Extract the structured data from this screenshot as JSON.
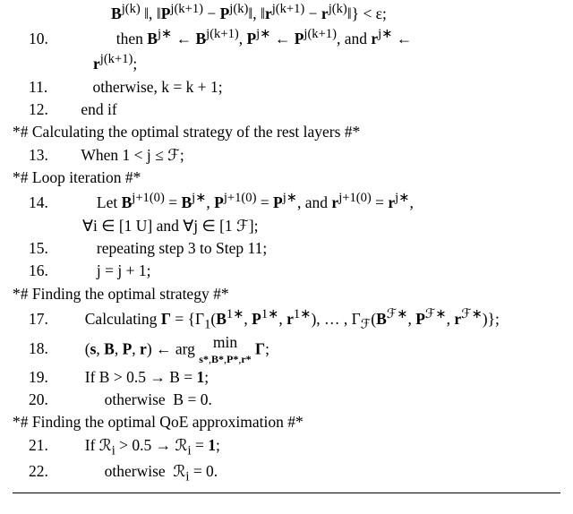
{
  "line0": "B^{j(k)} ‖, ‖P^{j(k+1)} − P^{j(k)}‖, ‖r^{j(k+1)} − r^{j(k)}‖} < ε;",
  "line10": "then B^{j∗} ← B^{j(k+1)}, P^{j∗} ← P^{j(k+1)}, and r^{j∗} ←",
  "line10b": "r^{j(k+1)};",
  "line11": "otherwise, k = k + 1;",
  "line12": "end if",
  "comment1": "*# Calculating the optimal strategy of the rest layers #*",
  "line13": "When 1 < j ≤ ℱ;",
  "comment2": "*# Loop iteration #*",
  "line14": "Let B^{j+1(0)} = B^{j∗}, P^{j+1(0)} = P^{j∗}, and r^{j+1(0)} = r^{j∗},",
  "line14b": "∀i ∈ [1 U] and ∀j ∈ [1 ℱ];",
  "line15": "repeating step 3 to Step 11;",
  "line16": "j = j + 1;",
  "comment3": "*# Finding the optimal strategy #*",
  "line17": "Calculating Γ = {Γ₁(B^{1∗}, P^{1∗}, r^{1∗}), … , Γ_ℱ(B^{ℱ∗}, P^{ℱ∗}, r^{ℱ∗})};",
  "line18": "(s, B, P, r) ← arg min_{s*,B*,P*,r*} Γ;",
  "line19": "If B > 0.5 → B = 1;",
  "line20": "otherwise  B = 0.",
  "comment4": "*# Finding the optimal QoE approximation #*",
  "line21": "If ℛᵢ > 0.5 → ℛᵢ = 1;",
  "line22": "otherwise  ℛᵢ = 0.",
  "nums": {
    "n10": "10.",
    "n11": "11.",
    "n12": "12.",
    "n13": "13.",
    "n14": "14.",
    "n15": "15.",
    "n16": "16.",
    "n17": "17.",
    "n18": "18.",
    "n19": "19.",
    "n20": "20.",
    "n21": "21.",
    "n22": "22."
  }
}
